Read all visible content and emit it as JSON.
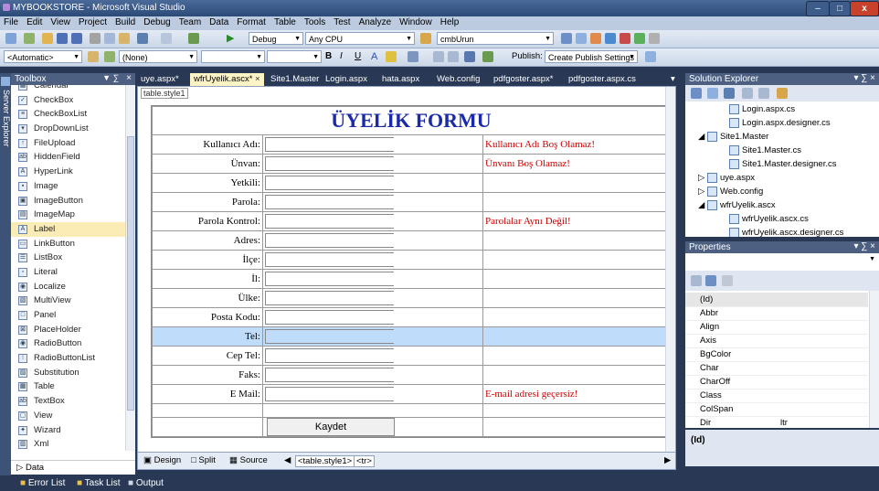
{
  "window": {
    "title": "MYBOOKSTORE - Microsoft Visual Studio"
  },
  "menu": [
    "File",
    "Edit",
    "View",
    "Project",
    "Build",
    "Debug",
    "Team",
    "Data",
    "Format",
    "Table",
    "Tools",
    "Test",
    "Analyze",
    "Window",
    "Help"
  ],
  "toolbar1": {
    "config": "Debug",
    "platform": "Any CPU",
    "find_combo": "cmbUrun"
  },
  "toolbar2": {
    "target": "<Automatic>",
    "style": "(None)",
    "publish_label": "Publish:",
    "publish_settings": "Create Publish Settings"
  },
  "toolbox": {
    "title": "Toolbox",
    "side_label": "Server Explorer",
    "items": [
      "Calendar",
      "CheckBox",
      "CheckBoxList",
      "DropDownList",
      "FileUpload",
      "HiddenField",
      "HyperLink",
      "Image",
      "ImageButton",
      "ImageMap",
      "Label",
      "LinkButton",
      "ListBox",
      "Literal",
      "Localize",
      "MultiView",
      "Panel",
      "PlaceHolder",
      "RadioButton",
      "RadioButtonList",
      "Substitution",
      "Table",
      "TextBox",
      "View",
      "Wizard",
      "Xml"
    ],
    "selected": "Label",
    "footer": "Data"
  },
  "tabs": [
    "uye.aspx*",
    "wfrUyelik.ascx*",
    "Site1.Master",
    "Login.aspx",
    "hata.aspx",
    "Web.config",
    "pdfgoster.aspx*",
    "pdfgoster.aspx.cs"
  ],
  "active_tab": "wfrUyelik.ascx*",
  "editor": {
    "element_tag": "table.style1",
    "form_title": "ÜYELİK FORMU",
    "rows": [
      {
        "label": "Kullanıcı Adı:",
        "error": "Kullanıcı Adı Boş Olamaz!"
      },
      {
        "label": "Ünvan:",
        "error": "Ünvanı Boş Olamaz!"
      },
      {
        "label": "Yetkili:",
        "error": ""
      },
      {
        "label": "Parola:",
        "error": ""
      },
      {
        "label": "Parola Kontrol:",
        "error": "Parolalar Aynı Değil!"
      },
      {
        "label": "Adres:",
        "error": ""
      },
      {
        "label": "İlçe:",
        "error": ""
      },
      {
        "label": "İl:",
        "error": ""
      },
      {
        "label": "Ülke:",
        "error": ""
      },
      {
        "label": "Posta Kodu:",
        "error": ""
      },
      {
        "label": "Tel:",
        "error": ""
      },
      {
        "label": "Cep Tel:",
        "error": ""
      },
      {
        "label": "Faks:",
        "error": ""
      },
      {
        "label": "E Mail:",
        "error": "E-mail adresi geçersiz!"
      }
    ],
    "button": "Kaydet"
  },
  "viewbar": {
    "design": "Design",
    "split": "Split",
    "source": "Source",
    "crumb1": "<table.style1>",
    "crumb2": "<tr>"
  },
  "solution_explorer": {
    "title": "Solution Explorer",
    "items": [
      "Login.aspx.cs",
      "Login.aspx.designer.cs",
      "Site1.Master",
      "Site1.Master.cs",
      "Site1.Master.designer.cs",
      "uye.aspx",
      "Web.config",
      "wfrUyelik.ascx",
      "wfrUyelik.ascx.cs",
      "wfrUyelik.ascx.designer.cs"
    ]
  },
  "properties": {
    "title": "Properties",
    "rows": [
      {
        "k": "(Id)",
        "v": ""
      },
      {
        "k": "Abbr",
        "v": ""
      },
      {
        "k": "Align",
        "v": ""
      },
      {
        "k": "Axis",
        "v": ""
      },
      {
        "k": "BgColor",
        "v": ""
      },
      {
        "k": "Char",
        "v": ""
      },
      {
        "k": "CharOff",
        "v": ""
      },
      {
        "k": "Class",
        "v": ""
      },
      {
        "k": "ColSpan",
        "v": ""
      },
      {
        "k": "Dir",
        "v": "ltr"
      }
    ],
    "desc_title": "(Id)"
  },
  "status": {
    "items": [
      "Error List",
      "Task List",
      "Output"
    ]
  }
}
